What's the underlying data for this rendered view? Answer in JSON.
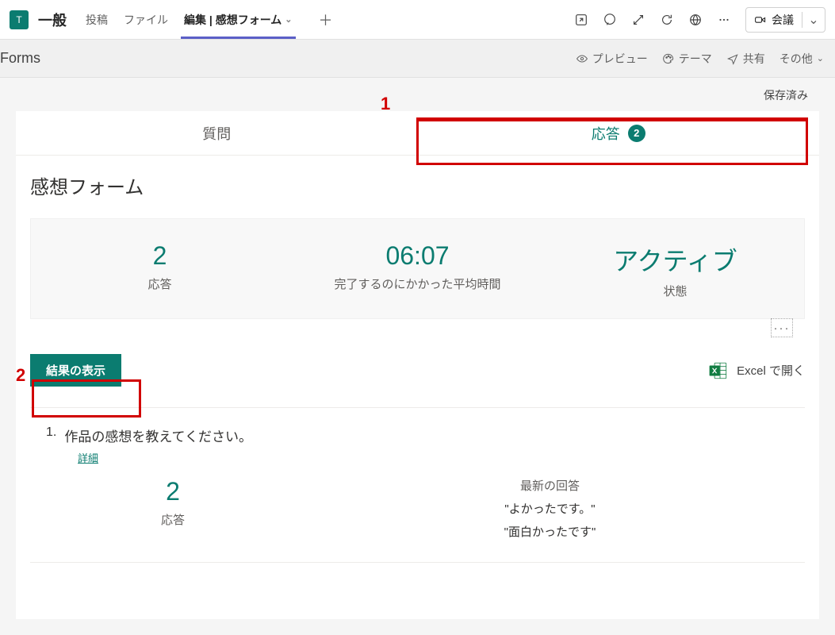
{
  "header": {
    "team_initial": "T",
    "channel": "一般",
    "tabs": [
      "投稿",
      "ファイル",
      "編集 | 感想フォーム"
    ],
    "active_tab_index": 2,
    "meeting_label": "会議"
  },
  "forms_bar": {
    "title": "Forms",
    "preview": "プレビュー",
    "theme": "テーマ",
    "share": "共有",
    "other": "その他"
  },
  "saved_label": "保存済み",
  "card": {
    "tab_questions": "質問",
    "tab_responses": "応答",
    "response_badge": "2",
    "form_title": "感想フォーム",
    "stats": {
      "responses_value": "2",
      "responses_label": "応答",
      "time_value": "06:07",
      "time_label": "完了するのにかかった平均時間",
      "status_value": "アクティブ",
      "status_label": "状態"
    },
    "show_results": "結果の表示",
    "excel_open": "Excel で開く",
    "question1": {
      "number": "1.",
      "text": "作品の感想を教えてください。",
      "detail": "詳細",
      "count_value": "2",
      "count_label": "応答",
      "latest_title": "最新の回答",
      "answer1": "\"よかったです。\"",
      "answer2": "\"面白かったです\""
    }
  },
  "annotations": {
    "a1": "1",
    "a2": "2"
  }
}
